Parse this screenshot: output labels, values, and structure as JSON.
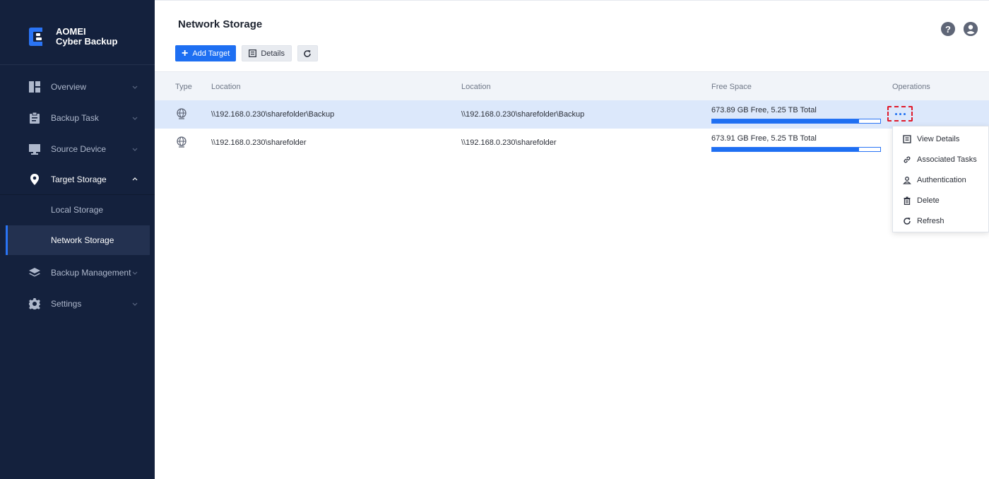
{
  "app": {
    "brand_line1": "AOMEI",
    "brand_line2": "Cyber Backup",
    "accent_color": "#1e6ff2",
    "sidebar_bg": "#14213d"
  },
  "sidebar": {
    "items": [
      {
        "label": "Overview",
        "icon": "dashboard-icon"
      },
      {
        "label": "Backup Task",
        "icon": "clipboard-icon"
      },
      {
        "label": "Source Device",
        "icon": "monitor-icon"
      },
      {
        "label": "Target Storage",
        "icon": "location-pin-icon",
        "expanded": true
      },
      {
        "label": "Backup Management",
        "icon": "layers-icon"
      },
      {
        "label": "Settings",
        "icon": "gear-icon"
      }
    ],
    "sub_items": [
      {
        "label": "Local Storage"
      },
      {
        "label": "Network Storage",
        "active": true
      }
    ]
  },
  "header": {
    "title": "Network Storage",
    "help_glyph": "?"
  },
  "toolbar": {
    "add_label": "Add Target",
    "details_label": "Details"
  },
  "table": {
    "columns": [
      "Type",
      "Location",
      "Location",
      "Free Space",
      "Operations"
    ],
    "rows": [
      {
        "location1": "\\\\192.168.0.230\\sharefolder\\Backup",
        "location2": "\\\\192.168.0.230\\sharefolder\\Backup",
        "free_space": "673.89 GB Free, 5.25 TB Total",
        "used_fraction": 0.872,
        "selected": true
      },
      {
        "location1": "\\\\192.168.0.230\\sharefolder",
        "location2": "\\\\192.168.0.230\\sharefolder",
        "free_space": "673.91 GB Free, 5.25 TB Total",
        "used_fraction": 0.872,
        "selected": false
      }
    ]
  },
  "ops_menu": {
    "items": [
      {
        "label": "View Details",
        "icon": "details-icon"
      },
      {
        "label": "Associated Tasks",
        "icon": "link-icon"
      },
      {
        "label": "Authentication",
        "icon": "user-icon"
      },
      {
        "label": "Delete",
        "icon": "trash-icon"
      },
      {
        "label": "Refresh",
        "icon": "refresh-icon"
      }
    ]
  }
}
